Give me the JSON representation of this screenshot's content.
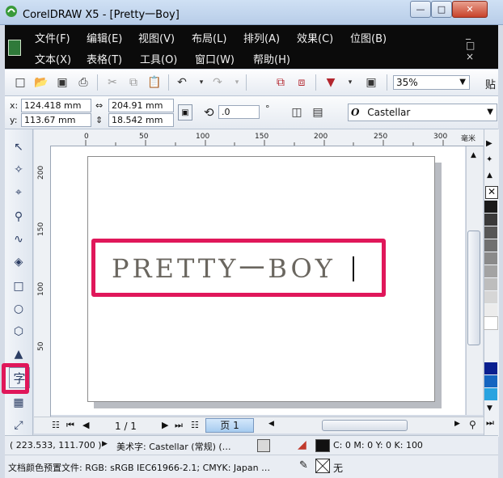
{
  "window": {
    "title": "CorelDRAW X5 - [Pretty一Boy]",
    "minimize": "—",
    "maximize": "□",
    "close": "✕"
  },
  "menu": {
    "row1": [
      "文件(F)",
      "编辑(E)",
      "视图(V)",
      "布局(L)",
      "排列(A)",
      "效果(C)",
      "位图(B)"
    ],
    "row2": [
      "文本(X)",
      "表格(T)",
      "工具(O)",
      "窗口(W)",
      "帮助(H)"
    ],
    "mdi_controls": "_ □ ×"
  },
  "standard_toolbar": {
    "icons": [
      "new-icon",
      "open-icon",
      "save-icon",
      "print-icon",
      "cut-icon",
      "copy-icon",
      "paste-icon",
      "undo-icon",
      "redo-icon",
      "import-icon",
      "export-icon",
      "launcher-icon",
      "welcome-icon"
    ],
    "zoom": "35%",
    "paste_label": "贴"
  },
  "property_bar": {
    "x_label": "x:",
    "x_value": "124.418 mm",
    "y_label": "y:",
    "y_value": "113.67 mm",
    "w_value": "204.91 mm",
    "h_value": "18.542 mm",
    "rotation": ".0",
    "degree": "°",
    "font_name": "Castellar"
  },
  "ruler": {
    "h_ticks": [
      "0",
      "50",
      "100",
      "150",
      "200",
      "250",
      "300"
    ],
    "h_unit": "毫米",
    "v_ticks": [
      "200",
      "150",
      "100",
      "50"
    ]
  },
  "document": {
    "text": "PRETTY一BOY"
  },
  "tools": [
    "pick-tool",
    "shape-tool",
    "crop-tool",
    "zoom-tool",
    "freehand-tool",
    "smart-fill-tool",
    "rectangle-tool",
    "ellipse-tool",
    "polygon-tool",
    "basic-shapes-tool",
    "text-tool",
    "table-tool",
    "connector-tool"
  ],
  "page_nav": {
    "counter": "1 / 1",
    "tab": "页 1"
  },
  "palette": [
    "#1a1a1a",
    "#3a3a3a",
    "#575757",
    "#707070",
    "#8a8a8a",
    "#a3a3a3",
    "#bdbdbd",
    "#d6d6d6",
    "#ececec",
    "#ffffff",
    "#0a1f8f",
    "#1565c0",
    "#29a3e0"
  ],
  "status": {
    "coords": "( 223.533, 111.700 )",
    "arrow": "▶",
    "object_info": "美术字: Castellar (常规) (…",
    "fill_info": "C: 0 M: 0 Y: 0 K: 100",
    "profile": "文档颜色预置文件: RGB: sRGB IEC61966-2.1; CMYK: Japan …",
    "outline": "无"
  },
  "colors": {
    "highlight": "#e0175a",
    "menubar": "#0b0b0b",
    "text": "#6a665f"
  }
}
